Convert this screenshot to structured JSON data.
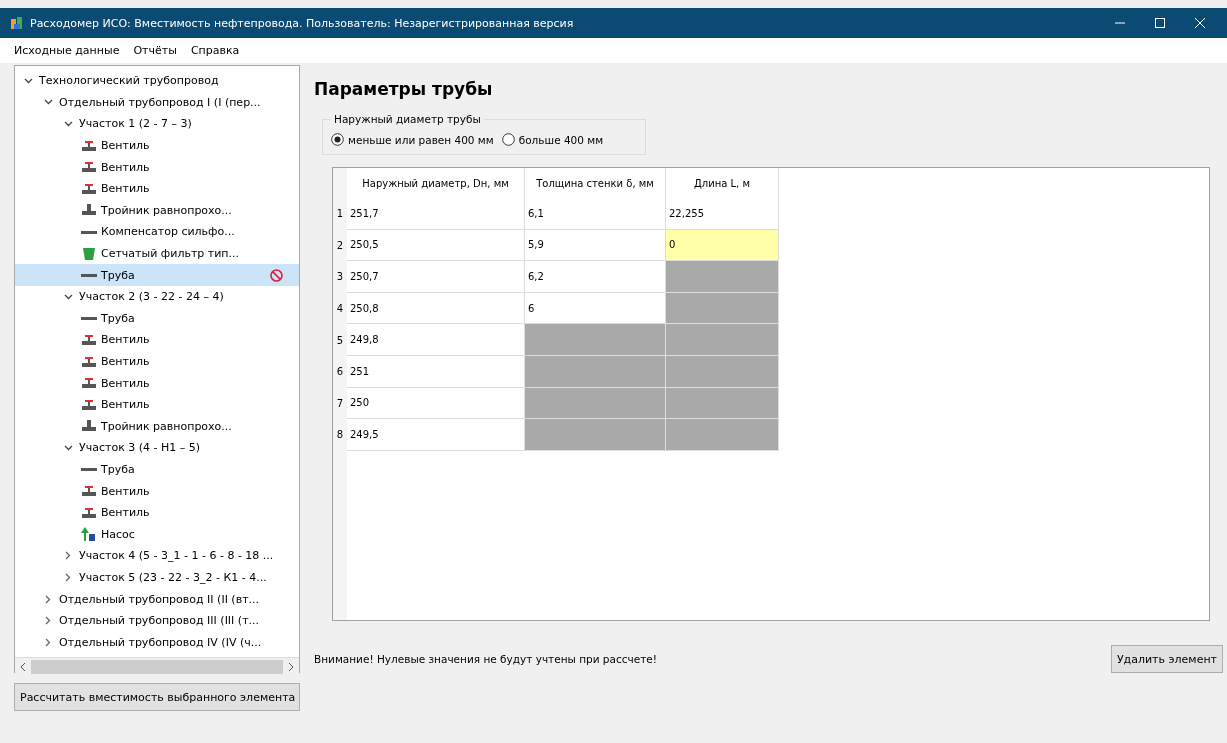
{
  "window": {
    "title": "Расходомер ИСО: Вместимость нефтепровода. Пользователь: Незарегистрированная версия"
  },
  "menu": [
    "Исходные данные",
    "Отчёты",
    "Справка"
  ],
  "tree": [
    {
      "label": "Технологический трубопровод",
      "expanded": true,
      "children": [
        {
          "label": "Отдельный трубопровод I (I (пер...",
          "expanded": true,
          "children": [
            {
              "label": "Участок 1 (2 - 7 – 3)",
              "expanded": true,
              "children": [
                {
                  "label": "Вентиль",
                  "kind": "valve",
                  "selected": false,
                  "invalid": false
                },
                {
                  "label": "Вентиль",
                  "kind": "valve",
                  "selected": false,
                  "invalid": false
                },
                {
                  "label": "Вентиль",
                  "kind": "valve",
                  "selected": false,
                  "invalid": false
                },
                {
                  "label": "Тройник равнопрохо...",
                  "kind": "tee",
                  "selected": false,
                  "invalid": false
                },
                {
                  "label": "Компенсатор сильфо...",
                  "kind": "compensator",
                  "selected": false,
                  "invalid": false
                },
                {
                  "label": "Сетчатый фильтр тип...",
                  "kind": "filter",
                  "selected": false,
                  "invalid": false
                },
                {
                  "label": "Труба",
                  "kind": "pipe",
                  "selected": true,
                  "invalid": true
                }
              ]
            },
            {
              "label": "Участок 2 (3 - 22 - 24 – 4)",
              "expanded": true,
              "children": [
                {
                  "label": "Труба",
                  "kind": "pipe",
                  "selected": false,
                  "invalid": false
                },
                {
                  "label": "Вентиль",
                  "kind": "valve",
                  "selected": false,
                  "invalid": false
                },
                {
                  "label": "Вентиль",
                  "kind": "valve",
                  "selected": false,
                  "invalid": false
                },
                {
                  "label": "Вентиль",
                  "kind": "valve",
                  "selected": false,
                  "invalid": false
                },
                {
                  "label": "Вентиль",
                  "kind": "valve",
                  "selected": false,
                  "invalid": false
                },
                {
                  "label": "Тройник равнопрохо...",
                  "kind": "tee",
                  "selected": false,
                  "invalid": false
                }
              ]
            },
            {
              "label": "Участок 3 (4 - Н1 – 5)",
              "expanded": true,
              "children": [
                {
                  "label": "Труба",
                  "kind": "pipe",
                  "selected": false,
                  "invalid": false
                },
                {
                  "label": "Вентиль",
                  "kind": "valve",
                  "selected": false,
                  "invalid": false
                },
                {
                  "label": "Вентиль",
                  "kind": "valve",
                  "selected": false,
                  "invalid": false
                },
                {
                  "label": "Насос",
                  "kind": "pump",
                  "selected": false,
                  "invalid": false
                }
              ]
            },
            {
              "label": "Участок 4 (5 - 3_1 - 1 - 6 - 8 - 18 ...",
              "expanded": false
            },
            {
              "label": "Участок 5 (23 - 22 - 3_2 - К1 - 4...",
              "expanded": false
            }
          ]
        },
        {
          "label": "Отдельный трубопровод II (II (вт...",
          "expanded": false
        },
        {
          "label": "Отдельный трубопровод III (III (т...",
          "expanded": false
        },
        {
          "label": "Отдельный трубопровод IV (IV (ч...",
          "expanded": false
        }
      ]
    }
  ],
  "calc_button": "Рассчитать вместимость выбранного элемента",
  "heading": "Параметры трубы",
  "diameter_group": {
    "title": "Наружный диаметр трубы",
    "options": [
      {
        "label": "меньше или равен 400 мм",
        "selected": true
      },
      {
        "label": "больше 400 мм",
        "selected": false
      }
    ]
  },
  "table": {
    "columns": [
      "Наружный диаметр, Dн, мм",
      "Толщина стенки δ, мм",
      "Длина L, м"
    ],
    "rows": [
      {
        "number": "1",
        "cells": [
          {
            "text": "251,7",
            "kind": "normal"
          },
          {
            "text": "6,1",
            "kind": "normal"
          },
          {
            "text": "22,255",
            "kind": "normal"
          }
        ]
      },
      {
        "number": "2",
        "cells": [
          {
            "text": "250,5",
            "kind": "normal"
          },
          {
            "text": "5,9",
            "kind": "normal"
          },
          {
            "text": "0",
            "kind": "warning"
          }
        ]
      },
      {
        "number": "3",
        "cells": [
          {
            "text": "250,7",
            "kind": "normal"
          },
          {
            "text": "6,2",
            "kind": "normal"
          },
          {
            "kind": "disabled"
          }
        ]
      },
      {
        "number": "4",
        "cells": [
          {
            "text": "250,8",
            "kind": "normal"
          },
          {
            "text": "6",
            "kind": "normal"
          },
          {
            "kind": "disabled"
          }
        ]
      },
      {
        "number": "5",
        "cells": [
          {
            "text": "249,8",
            "kind": "normal"
          },
          {
            "kind": "disabled"
          },
          {
            "kind": "disabled"
          }
        ]
      },
      {
        "number": "6",
        "cells": [
          {
            "text": "251",
            "kind": "normal"
          },
          {
            "kind": "disabled"
          },
          {
            "kind": "disabled"
          }
        ]
      },
      {
        "number": "7",
        "cells": [
          {
            "text": "250",
            "kind": "normal"
          },
          {
            "kind": "disabled"
          },
          {
            "kind": "disabled"
          }
        ]
      },
      {
        "number": "8",
        "cells": [
          {
            "text": "249,5",
            "kind": "normal"
          },
          {
            "kind": "disabled"
          },
          {
            "kind": "disabled"
          }
        ]
      }
    ]
  },
  "warning": "Внимание! Нулевые значения не будут учтены при рассчете!",
  "delete_button": "Удалить элемент"
}
